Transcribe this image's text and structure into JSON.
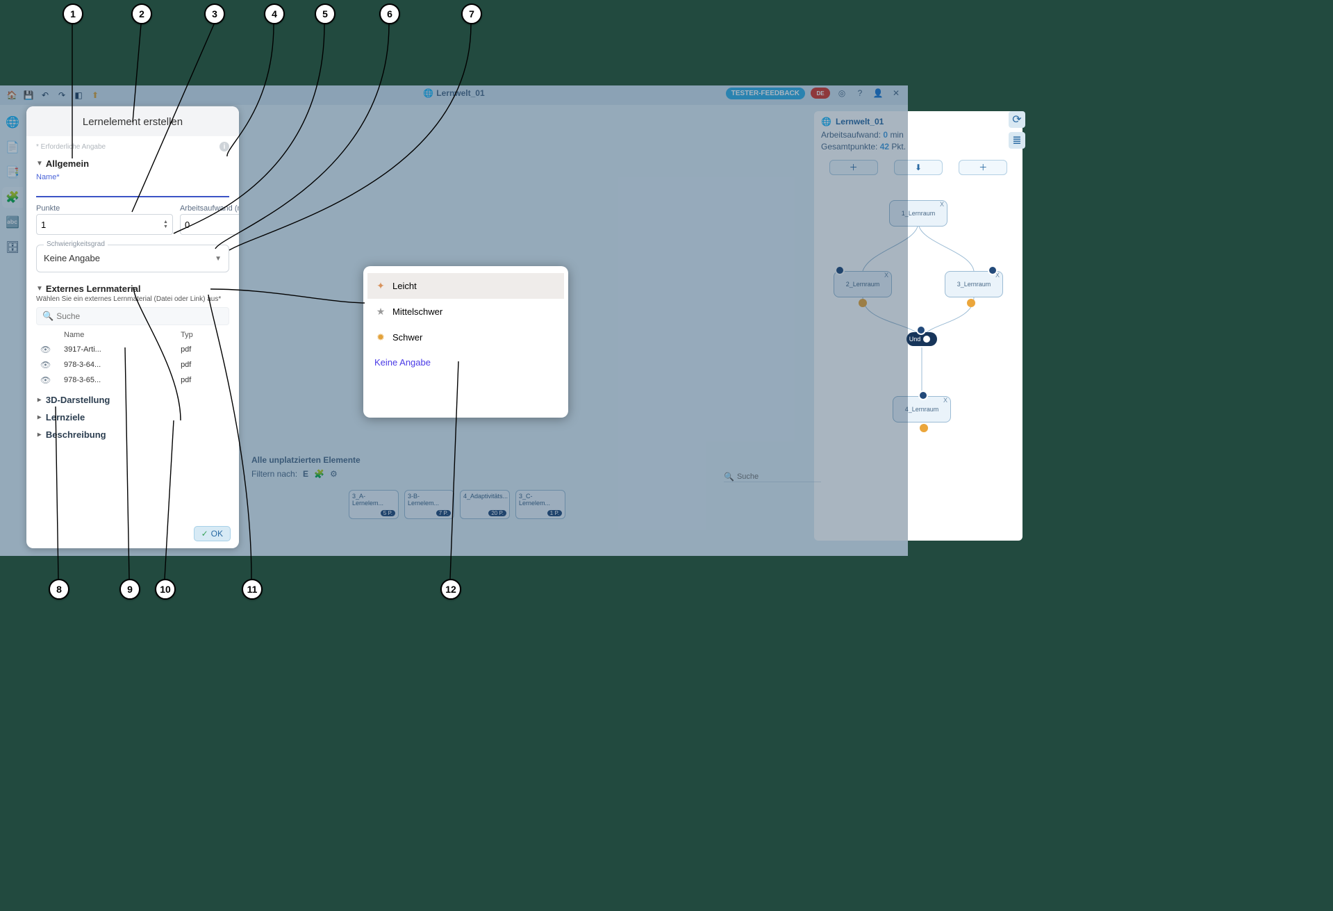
{
  "domain": "Computer-Use",
  "toolbar": {
    "title": "Lernwelt_01",
    "tester_feedback": "TESTER-FEEDBACK",
    "lang": "DE"
  },
  "dialog": {
    "title": "Lernelement erstellen",
    "required_note": "* Erforderliche Angabe",
    "section_general": "Allgemein",
    "name_label": "Name*",
    "name_value": "",
    "points_label": "Punkte",
    "points_value": "1",
    "effort_label": "Arbeitsaufwand (min)",
    "effort_value": "0",
    "difficulty_label": "Schwierigkeitsgrad",
    "difficulty_value": "Keine Angabe",
    "section_external": "Externes Lernmaterial",
    "external_note": "Wählen Sie ein externes Lernmaterial (Datei oder Link) aus*",
    "search_placeholder": "Suche",
    "col_name": "Name",
    "col_type": "Typ",
    "materials": [
      {
        "name": "3917-Arti...",
        "type": "pdf"
      },
      {
        "name": "978-3-64...",
        "type": "pdf"
      },
      {
        "name": "978-3-65...",
        "type": "pdf"
      }
    ],
    "section_3d": "3D-Darstellung",
    "section_goals": "Lernziele",
    "section_desc": "Beschreibung",
    "ok": "OK"
  },
  "difficulty_popover": {
    "options": [
      {
        "key": "leicht",
        "label": "Leicht"
      },
      {
        "key": "mittel",
        "label": "Mittelschwer"
      },
      {
        "key": "schwer",
        "label": "Schwer"
      },
      {
        "key": "none",
        "label": "Keine Angabe"
      }
    ]
  },
  "world_panel": {
    "title": "Lernwelt_01",
    "meta_effort_label": "Arbeitsaufwand:",
    "meta_effort_value": "0",
    "meta_effort_unit": "min",
    "meta_points_label": "Gesamtpunkte:",
    "meta_points_value": "42",
    "meta_points_unit": "Pkt.",
    "nodes": [
      {
        "label": "1_Lernraum"
      },
      {
        "label": "2_Lernraum"
      },
      {
        "label": "3_Lernraum"
      },
      {
        "label": "4_Lernraum"
      }
    ],
    "logic_label": "Und"
  },
  "unplaced_bar": {
    "title": "Alle unplatzierten Elemente",
    "filter_label": "Filtern nach:",
    "search_placeholder": "Suche",
    "cards": [
      {
        "name": "3_A-Lernelem...",
        "pts": "5 P."
      },
      {
        "name": "3-B-Lernelem...",
        "pts": "7 P."
      },
      {
        "name": "4_Adaptivitäts...",
        "pts": "20 P."
      },
      {
        "name": "3_C-Lernelem...",
        "pts": "1 P."
      }
    ]
  },
  "callouts": [
    {
      "n": "1"
    },
    {
      "n": "2"
    },
    {
      "n": "3"
    },
    {
      "n": "4"
    },
    {
      "n": "5"
    },
    {
      "n": "6"
    },
    {
      "n": "7"
    },
    {
      "n": "8"
    },
    {
      "n": "9"
    },
    {
      "n": "10"
    },
    {
      "n": "11"
    },
    {
      "n": "12"
    }
  ]
}
